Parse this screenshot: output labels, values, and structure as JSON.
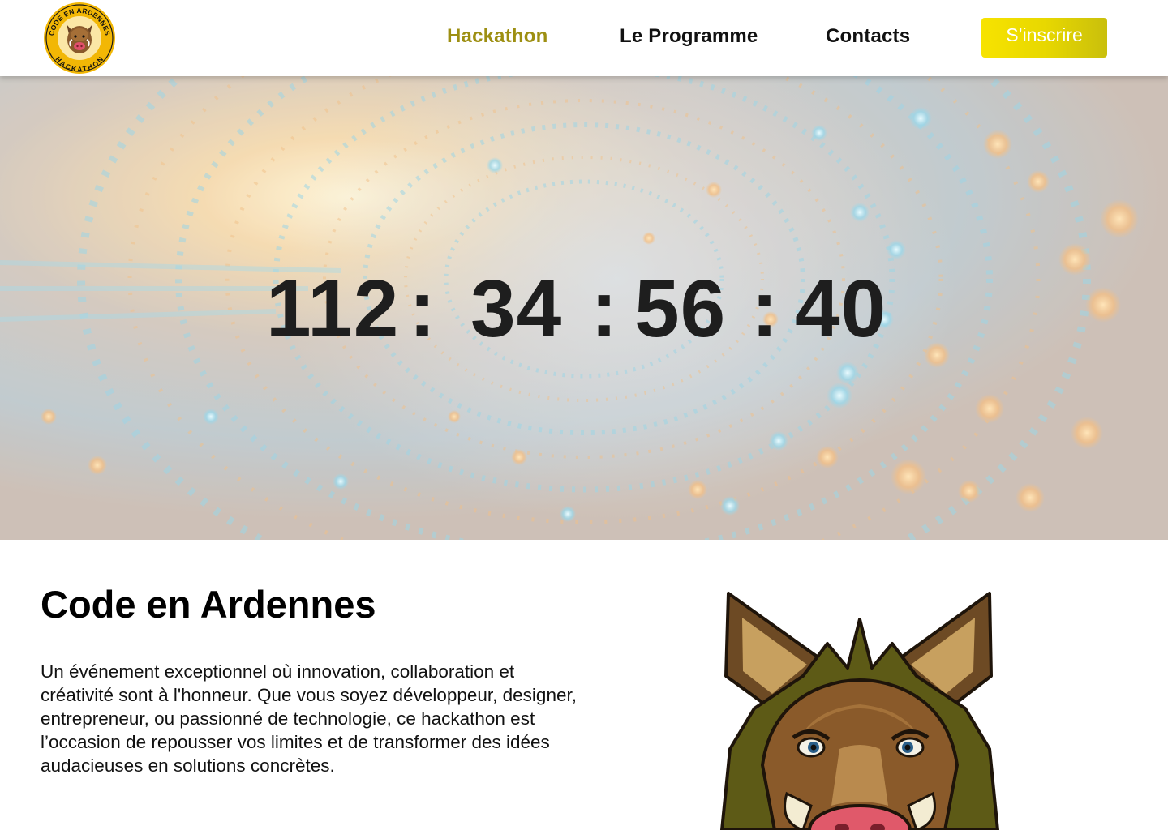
{
  "header": {
    "logo": {
      "icon": "boar-logo-icon",
      "text_top": "CODE EN ARDENNES",
      "text_bottom": "HACKATHON"
    },
    "nav": [
      {
        "label": "Hackathon",
        "active": true
      },
      {
        "label": "Le Programme",
        "active": false
      },
      {
        "label": "Contacts",
        "active": false
      }
    ],
    "cta_label": "S’inscrire"
  },
  "hero": {
    "countdown": {
      "days": "112",
      "hours": "34",
      "minutes": "56",
      "seconds": "40",
      "separator": ":"
    }
  },
  "about": {
    "title": "Code en Ardennes",
    "text": "Un événement exceptionnel où innovation, collaboration et créativité sont à l'honneur. Que vous soyez développeur, designer, entrepreneur, ou passionné de technologie, ce hackathon est l’occasion de repousser vos limites et de transformer des idées audacieuses en solutions concrètes.",
    "illustration": "boar-head-icon"
  },
  "colors": {
    "accent": "#9d8f12",
    "cta_start": "#f7e300",
    "cta_end": "#c9bf0c",
    "text": "#111111"
  }
}
